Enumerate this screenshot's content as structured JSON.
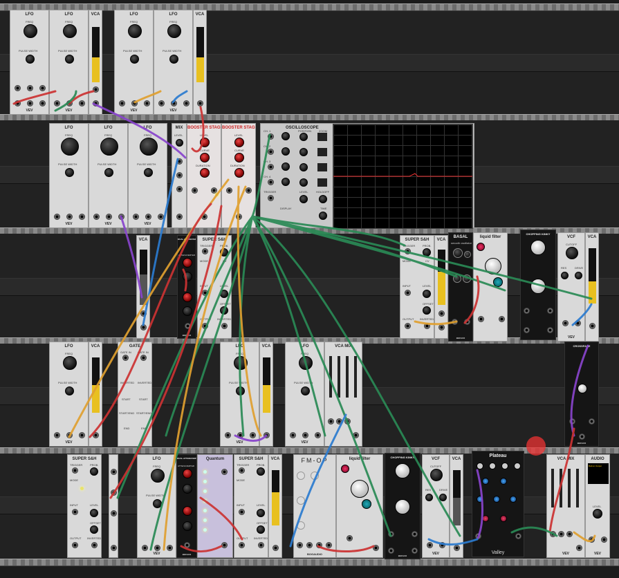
{
  "modules": {
    "lfo_title": "LFO",
    "lfo_freq": "FREQ",
    "lfo_pw": "PULSE WIDTH",
    "lfo_brand": "VEV",
    "vca_title": "VCA",
    "mix_title": "MIX",
    "mix_level": "LEVEL",
    "booster_title": "BOOSTER STAGE",
    "booster_level": "LEVEL",
    "booster_curve": "CURVE",
    "booster_duration": "DURATION",
    "scope_title": "OSCILLOSCOPE",
    "scope_ch1": "CH. 1",
    "scope_ch2": "CH. 2",
    "scope_ch3": "CH. 3",
    "scope_ch4": "CH. 4",
    "scope_position": "POSITION",
    "scope_zoom": "ZOOM",
    "scope_trigger": "TRIGGER",
    "scope_level": "LEVEL",
    "scope_holdoff": "HOLDOFF",
    "scope_time": "TIME",
    "scope_display": "DISPLAY",
    "supersh_title": "SUPER S&H",
    "supersh_trigger": "TRIGGER",
    "supersh_prob": "PROB.",
    "supersh_mode": "MODE",
    "supersh_cv": "CV",
    "supersh_input": "INPUT",
    "supersh_level": "LEVEL",
    "supersh_offset": "OFFSET",
    "supersh_output": "OUTPUT",
    "supersh_inverted": "INVERTED",
    "dual_atten_title": "DUAL ATTENUVERTER",
    "dual_atten_label": "ATTENUVERTER",
    "basal_title": "BASAL",
    "basal_sub": "smooth oscillator",
    "liquid_title": "liquid filter",
    "chopping_title": "CHOPPING KINKY",
    "vcf_title": "VCF",
    "vcf_cutoff": "CUTOFF",
    "vcf_res": "RES",
    "vcf_drive": "DRIVE",
    "gate_title": "GATE",
    "gate_in": "GATE IN",
    "gate_inverted": "INVERTED",
    "gate_start": "START",
    "gate_startend": "START/END",
    "gate_end": "END",
    "vcamix_title": "VCA MIX",
    "crossfade_title": "CROSSFADE",
    "quantum_title": "Quantum",
    "fmop_title": "FM-OP",
    "fmop_brand": "BOGAUDIO",
    "plateau_title": "Plateau",
    "plateau_brand": "Valley",
    "audio_title": "AUDIO",
    "audio_device": "Built-in Output",
    "audio_level": "LEVEL",
    "befaco": "BEFACO"
  }
}
